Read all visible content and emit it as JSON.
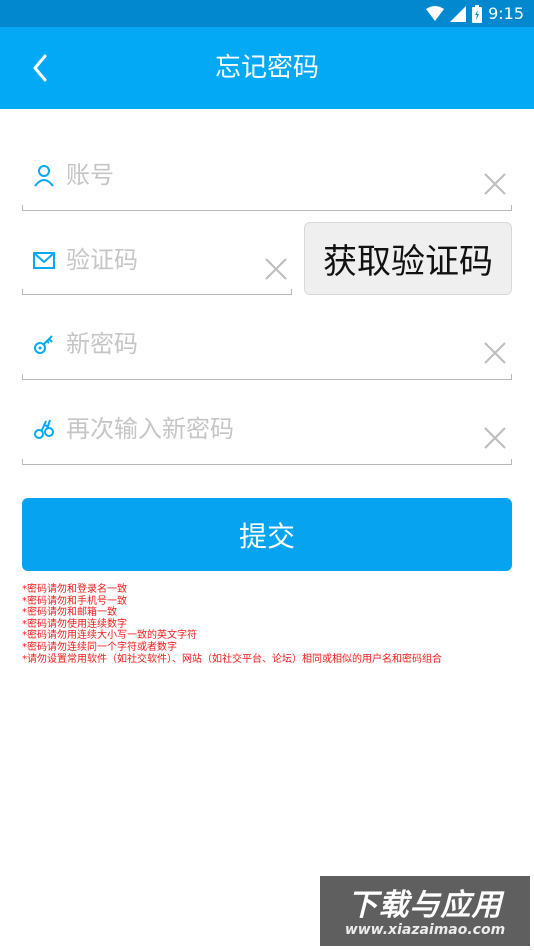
{
  "status_bar": {
    "time": "9:15"
  },
  "header": {
    "title": "忘记密码"
  },
  "form": {
    "account_placeholder": "账号",
    "code_placeholder": "验证码",
    "get_code_label": "获取验证码",
    "new_password_placeholder": "新密码",
    "confirm_password_placeholder": "再次输入新密码",
    "submit_label": "提交"
  },
  "hints": [
    "*密码请勿和登录名一致",
    "*密码请勿和手机号一致",
    "*密码请勿和邮箱一致",
    "*密码请勿使用连续数字",
    "*密码请勿用连续大小写一致的英文字符",
    "*密码请勿连续同一个字符或者数字",
    "*请勿设置常用软件（如社交软件）、网站（如社交平台、论坛）相同或相似的用户名和密码组合"
  ],
  "watermark": {
    "title": "下载与应用",
    "url": "www.xiazaimao.com"
  },
  "colors": {
    "primary": "#03a9f4",
    "status_bar": "#0288cf",
    "hint_red": "#f21b1b"
  }
}
